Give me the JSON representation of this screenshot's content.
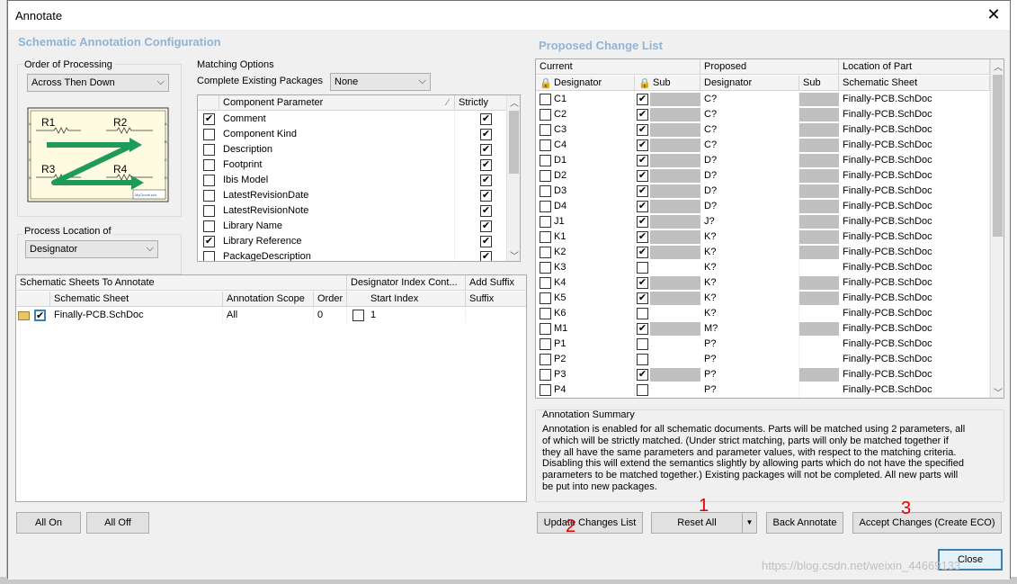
{
  "window": {
    "title": "Annotate"
  },
  "left": {
    "section_title": "Schematic Annotation Configuration",
    "order_label": "Order of Processing",
    "order_value": "Across Then Down",
    "preview_labels": [
      "R1",
      "R2",
      "R3",
      "R4"
    ],
    "preview_footer": "MyCircuit.sch",
    "location_label": "Process Location of",
    "location_value": "Designator",
    "matching_label": "Matching Options",
    "complete_label": "Complete Existing Packages",
    "complete_value": "None",
    "param_headers": {
      "param": "Component Parameter",
      "strict": "Strictly"
    },
    "params": [
      {
        "name": "Comment",
        "checked": true,
        "strict": true
      },
      {
        "name": "Component Kind",
        "checked": false,
        "strict": true
      },
      {
        "name": "Description",
        "checked": false,
        "strict": true
      },
      {
        "name": "Footprint",
        "checked": false,
        "strict": true
      },
      {
        "name": "Ibis Model",
        "checked": false,
        "strict": true
      },
      {
        "name": "LatestRevisionDate",
        "checked": false,
        "strict": true
      },
      {
        "name": "LatestRevisionNote",
        "checked": false,
        "strict": true
      },
      {
        "name": "Library Name",
        "checked": false,
        "strict": true
      },
      {
        "name": "Library Reference",
        "checked": true,
        "strict": true
      },
      {
        "name": "PackageDescription",
        "checked": false,
        "strict": true
      }
    ],
    "sheets_headers": {
      "group1": "Schematic Sheets To Annotate",
      "group2": "Designator Index Cont...",
      "group3": "Add Suffix",
      "sheet": "Schematic Sheet",
      "scope": "Annotation Scope",
      "order": "Order",
      "start": "Start Index",
      "suffix": "Suffix"
    },
    "sheets": [
      {
        "sheet": "Finally-PCB.SchDoc",
        "scope": "All",
        "order": "0",
        "start": "1",
        "suffix": ""
      }
    ],
    "all_on": "All On",
    "all_off": "All Off"
  },
  "right": {
    "section_title": "Proposed Change List",
    "headers": {
      "current": "Current",
      "proposed": "Proposed",
      "location": "Location of Part",
      "designator": "Designator",
      "sub": "Sub",
      "pdesignator": "Designator",
      "psub": "Sub",
      "sheet": "Schematic Sheet"
    },
    "rows": [
      {
        "cur": "C1",
        "sub": true,
        "prop": "C?",
        "sheet": "Finally-PCB.SchDoc"
      },
      {
        "cur": "C2",
        "sub": true,
        "prop": "C?",
        "sheet": "Finally-PCB.SchDoc"
      },
      {
        "cur": "C3",
        "sub": true,
        "prop": "C?",
        "sheet": "Finally-PCB.SchDoc"
      },
      {
        "cur": "C4",
        "sub": true,
        "prop": "C?",
        "sheet": "Finally-PCB.SchDoc"
      },
      {
        "cur": "D1",
        "sub": true,
        "prop": "D?",
        "sheet": "Finally-PCB.SchDoc"
      },
      {
        "cur": "D2",
        "sub": true,
        "prop": "D?",
        "sheet": "Finally-PCB.SchDoc"
      },
      {
        "cur": "D3",
        "sub": true,
        "prop": "D?",
        "sheet": "Finally-PCB.SchDoc"
      },
      {
        "cur": "D4",
        "sub": true,
        "prop": "D?",
        "sheet": "Finally-PCB.SchDoc"
      },
      {
        "cur": "J1",
        "sub": true,
        "prop": "J?",
        "sheet": "Finally-PCB.SchDoc"
      },
      {
        "cur": "K1",
        "sub": true,
        "prop": "K?",
        "sheet": "Finally-PCB.SchDoc"
      },
      {
        "cur": "K2",
        "sub": true,
        "prop": "K?",
        "sheet": "Finally-PCB.SchDoc"
      },
      {
        "cur": "K3",
        "sub": false,
        "prop": "K?",
        "sheet": "Finally-PCB.SchDoc"
      },
      {
        "cur": "K4",
        "sub": true,
        "prop": "K?",
        "sheet": "Finally-PCB.SchDoc"
      },
      {
        "cur": "K5",
        "sub": true,
        "prop": "K?",
        "sheet": "Finally-PCB.SchDoc"
      },
      {
        "cur": "K6",
        "sub": false,
        "prop": "K?",
        "sheet": "Finally-PCB.SchDoc"
      },
      {
        "cur": "M1",
        "sub": true,
        "prop": "M?",
        "sheet": "Finally-PCB.SchDoc"
      },
      {
        "cur": "P1",
        "sub": false,
        "prop": "P?",
        "sheet": "Finally-PCB.SchDoc"
      },
      {
        "cur": "P2",
        "sub": false,
        "prop": "P?",
        "sheet": "Finally-PCB.SchDoc"
      },
      {
        "cur": "P3",
        "sub": true,
        "prop": "P?",
        "sheet": "Finally-PCB.SchDoc"
      },
      {
        "cur": "P4",
        "sub": false,
        "prop": "P?",
        "sheet": "Finally-PCB.SchDoc"
      }
    ],
    "summary_title": "Annotation Summary",
    "summary_lines": [
      "Annotation is enabled for all schematic documents. Parts will be matched using 2 parameters, all",
      "of which will be strictly matched. (Under strict matching, parts will only be matched together if",
      "they all have the same parameters and parameter values, with respect to the matching criteria.",
      "Disabling this will extend the semantics slightly by allowing parts which do not have the specified",
      "parameters to be matched together.) Existing packages will not be completed. All new parts will",
      "be put into new packages."
    ]
  },
  "buttons": {
    "update": "Update Changes List",
    "reset": "Reset All",
    "back": "Back Annotate",
    "accept": "Accept Changes (Create ECO)",
    "close": "Close"
  },
  "marks": {
    "m1": "1",
    "m2": "2",
    "m3": "3"
  },
  "watermark": "https://blog.csdn.net/weixin_44669133",
  "colors": {
    "section_title": "#92b4d4",
    "mark": "#e00000",
    "arrow": "#1e9b5a"
  }
}
